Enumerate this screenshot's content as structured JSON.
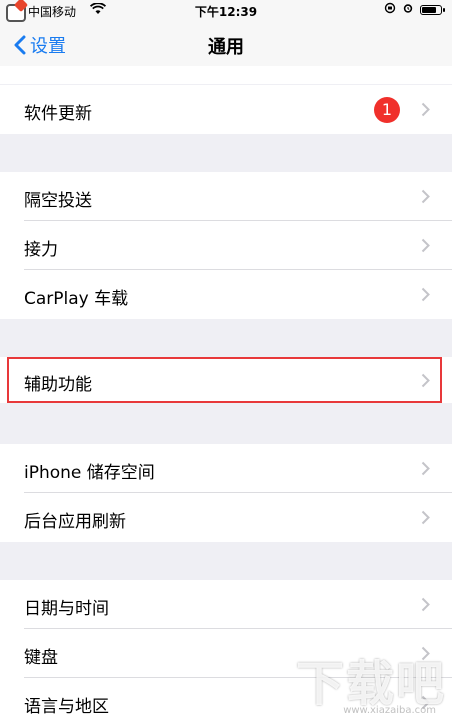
{
  "status_bar": {
    "carrier": "中国移动",
    "time": "下午12:39",
    "battery_level": 0.85
  },
  "nav": {
    "back_label": "设置",
    "title": "通用"
  },
  "groups": {
    "update": {
      "label": "软件更新",
      "badge": "1"
    },
    "sharing": [
      {
        "label": "隔空投送"
      },
      {
        "label": "接力"
      },
      {
        "label": "CarPlay 车载"
      }
    ],
    "accessibility": {
      "label": "辅助功能"
    },
    "storage": [
      {
        "label": "iPhone 储存空间"
      },
      {
        "label": "后台应用刷新"
      }
    ],
    "system": [
      {
        "label": "日期与时间"
      },
      {
        "label": "键盘"
      },
      {
        "label": "语言与地区"
      }
    ]
  },
  "watermark": {
    "text": "下载吧",
    "url": "www.xiazaiba.com"
  },
  "colors": {
    "accent": "#1a7cf0",
    "badge": "#f0302b",
    "highlight": "#e8383a",
    "background": "#efeff4"
  }
}
